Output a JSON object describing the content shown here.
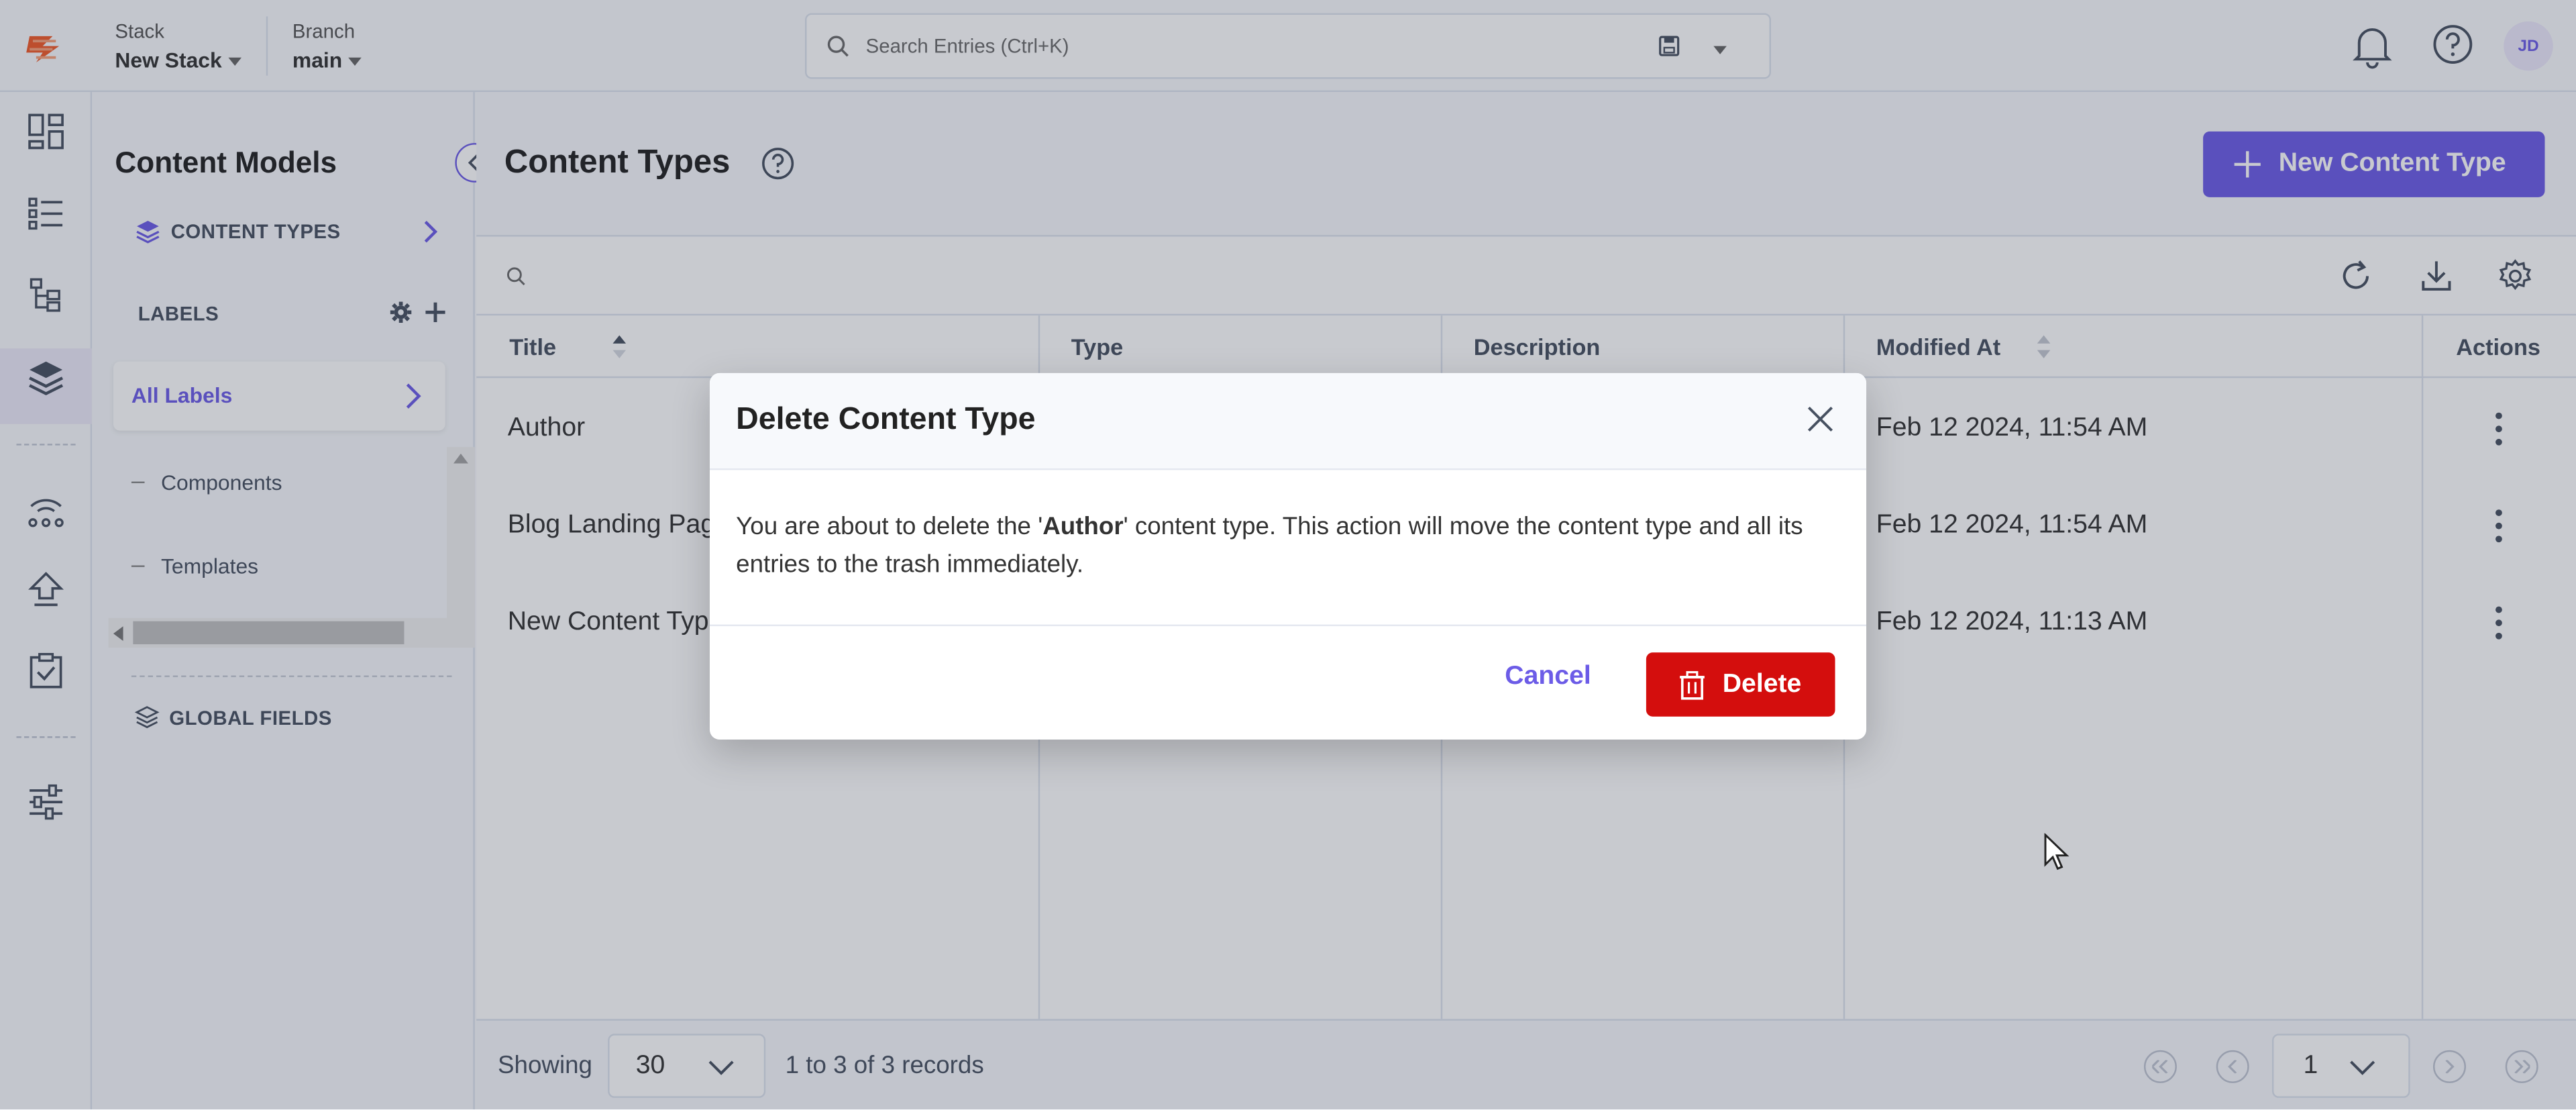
{
  "header": {
    "stack_label": "Stack",
    "stack_value": "New Stack",
    "branch_label": "Branch",
    "branch_value": "main",
    "search_placeholder": "Search Entries (Ctrl+K)",
    "avatar_initials": "JD"
  },
  "sidebar": {
    "title": "Content Models",
    "content_types_label": "CONTENT TYPES",
    "labels_heading": "LABELS",
    "all_labels": "All Labels",
    "tree": [
      "Components",
      "Templates"
    ],
    "global_fields_label": "GLOBAL FIELDS"
  },
  "main": {
    "title": "Content Types",
    "new_button": "New Content Type",
    "columns": [
      "Title",
      "Type",
      "Description",
      "Modified At",
      "Actions"
    ],
    "rows": [
      {
        "title": "Author",
        "modified": "Feb 12 2024, 11:54 AM"
      },
      {
        "title": "Blog Landing Page",
        "modified": "Feb 12 2024, 11:54 AM"
      },
      {
        "title": "New Content Type",
        "modified": "Feb 12 2024, 11:13 AM"
      }
    ]
  },
  "footer": {
    "showing_label": "Showing",
    "page_size": "30",
    "records_text": "1 to 3 of 3 records",
    "page_number": "1"
  },
  "modal": {
    "title": "Delete Content Type",
    "body_prefix": "You are about to delete the '",
    "body_name": "Author",
    "body_suffix": "' content type. This action will move the content type and all its entries to the trash immediately.",
    "cancel_label": "Cancel",
    "delete_label": "Delete"
  },
  "colors": {
    "accent": "#6c5ce7",
    "danger": "#d40e0d",
    "logo": "#f05a28"
  }
}
